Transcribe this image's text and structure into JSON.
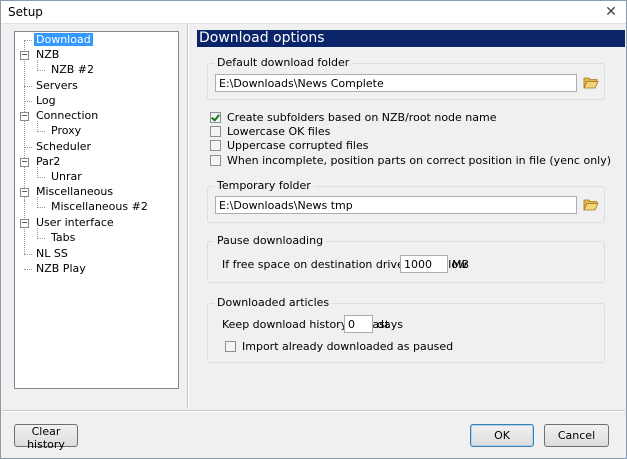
{
  "window": {
    "title": "Setup",
    "close_symbol": "✕"
  },
  "tree": {
    "items": [
      {
        "label": "Download",
        "selected": true
      },
      {
        "label": "NZB"
      },
      {
        "label": "NZB #2"
      },
      {
        "label": "Servers"
      },
      {
        "label": "Log"
      },
      {
        "label": "Connection"
      },
      {
        "label": "Proxy"
      },
      {
        "label": "Scheduler"
      },
      {
        "label": "Par2"
      },
      {
        "label": "Unrar"
      },
      {
        "label": "Miscellaneous"
      },
      {
        "label": "Miscellaneous #2"
      },
      {
        "label": "User interface"
      },
      {
        "label": "Tabs"
      },
      {
        "label": "NL SS"
      },
      {
        "label": "NZB Play"
      }
    ],
    "expander_symbol": "−"
  },
  "panel": {
    "header": "Download options",
    "default_folder": {
      "title": "Default download folder",
      "value": "E:\\Downloads\\News Complete",
      "icon": "folder-open-icon"
    },
    "options": [
      {
        "label": "Create subfolders based on NZB/root node name",
        "checked": true
      },
      {
        "label": "Lowercase OK files",
        "checked": false
      },
      {
        "label": "Uppercase corrupted files",
        "checked": false
      },
      {
        "label": "When incomplete, position parts on correct position in file (yenc only)",
        "checked": false
      }
    ],
    "temp_folder": {
      "title": "Temporary folder",
      "value": "E:\\Downloads\\News tmp",
      "icon": "folder-open-icon"
    },
    "pause": {
      "title": "Pause downloading",
      "label": "If free space on destination drive gets below",
      "value": "1000",
      "unit": "MB"
    },
    "downloaded": {
      "title": "Downloaded articles",
      "history_label": "Keep download history for last",
      "history_value": "0",
      "history_unit": "days",
      "import_label": "Import already downloaded as paused",
      "import_checked": false
    }
  },
  "buttons": {
    "clear_history": "Clear history",
    "ok": "OK",
    "cancel": "Cancel"
  },
  "colors": {
    "header_bg": "#0a246a",
    "selection": "#3399ff",
    "check_mark": "#1e7a1e",
    "folder": "#e8b54a"
  }
}
